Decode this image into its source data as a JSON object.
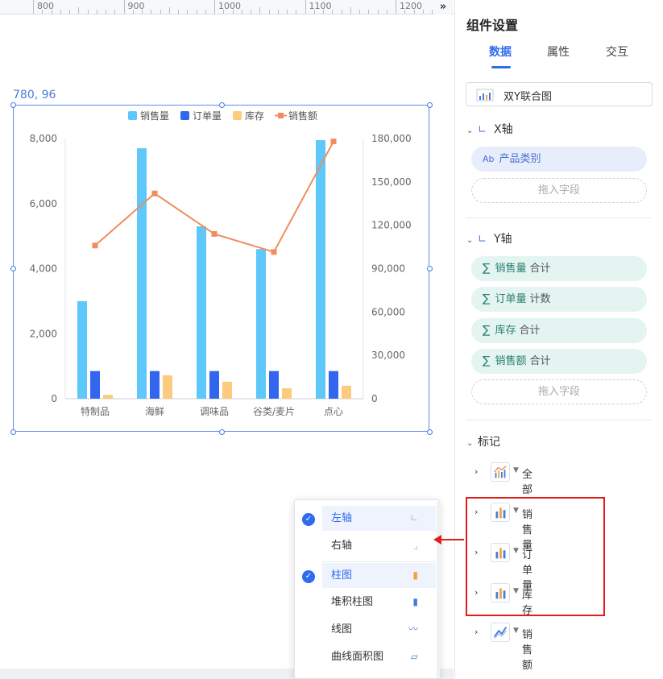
{
  "ruler": {
    "labels": [
      "800",
      "900",
      "1000",
      "1100",
      "1200"
    ],
    "expand_icon": "»"
  },
  "canvas": {
    "coord_label": "780, 96"
  },
  "panel": {
    "title": "组件设置",
    "tabs": [
      "数据",
      "属性",
      "交互"
    ],
    "active_tab": "数据",
    "chart_type": "双Y联合图",
    "x_axis": {
      "title": "X轴",
      "field": "产品类别",
      "field_prefix": "Ab",
      "drop_hint": "拖入字段"
    },
    "y_axis": {
      "title": "Y轴",
      "fields": [
        {
          "name": "销售量",
          "agg": "合计"
        },
        {
          "name": "订单量",
          "agg": "计数"
        },
        {
          "name": "库存",
          "agg": "合计"
        },
        {
          "name": "销售额",
          "agg": "合计"
        }
      ],
      "drop_hint": "拖入字段"
    },
    "marks": {
      "title": "标记",
      "rows": [
        {
          "label": "全部",
          "icon": "combo-chart-icon"
        },
        {
          "label": "销售量",
          "icon": "bar-chart-icon"
        },
        {
          "label": "订单量",
          "icon": "bar-chart-icon"
        },
        {
          "label": "库存",
          "icon": "bar-chart-icon"
        },
        {
          "label": "销售额",
          "icon": "line-chart-icon"
        }
      ]
    }
  },
  "menu": {
    "items": [
      {
        "label": "左轴",
        "checked": true,
        "icon": "left-axis-icon"
      },
      {
        "label": "右轴",
        "checked": false,
        "icon": "right-axis-icon"
      },
      {
        "label": "柱图",
        "checked": true,
        "icon": "bar-chart-icon"
      },
      {
        "label": "堆积柱图",
        "checked": false,
        "icon": "stacked-bar-icon"
      },
      {
        "label": "线图",
        "checked": false,
        "icon": "line-chart-icon"
      },
      {
        "label": "曲线面积图",
        "checked": false,
        "icon": "area-chart-icon"
      }
    ]
  },
  "colors": {
    "accent": "#2f6bf0",
    "sales_volume": "#5ec8fb",
    "orders": "#3366ee",
    "stock": "#fccb7e",
    "sales_amount": "#f28c5c",
    "highlight": "#e21d1d"
  },
  "chart_data": {
    "type": "bar",
    "categories": [
      "特制品",
      "海鲜",
      "调味品",
      "谷类/麦片",
      "点心"
    ],
    "series": [
      {
        "name": "销售量",
        "type": "bar",
        "axis": "left",
        "values": [
          3000,
          7700,
          5300,
          4600,
          7950
        ]
      },
      {
        "name": "订单量",
        "type": "bar",
        "axis": "left",
        "values": [
          850,
          850,
          850,
          850,
          850
        ]
      },
      {
        "name": "库存",
        "type": "bar",
        "axis": "left",
        "values": [
          120,
          720,
          520,
          320,
          400
        ]
      },
      {
        "name": "销售额",
        "type": "line",
        "axis": "right",
        "values": [
          106000,
          142000,
          114000,
          101500,
          178000
        ]
      }
    ],
    "y_left": {
      "range": [
        0,
        8000
      ],
      "ticks": [
        "0",
        "2,000",
        "4,000",
        "6,000",
        "8,000"
      ]
    },
    "y_right": {
      "range": [
        0,
        180000
      ],
      "ticks": [
        "0",
        "30,000",
        "60,000",
        "90,000",
        "120,000",
        "150,000",
        "180,000"
      ]
    },
    "legend": "top-center"
  }
}
